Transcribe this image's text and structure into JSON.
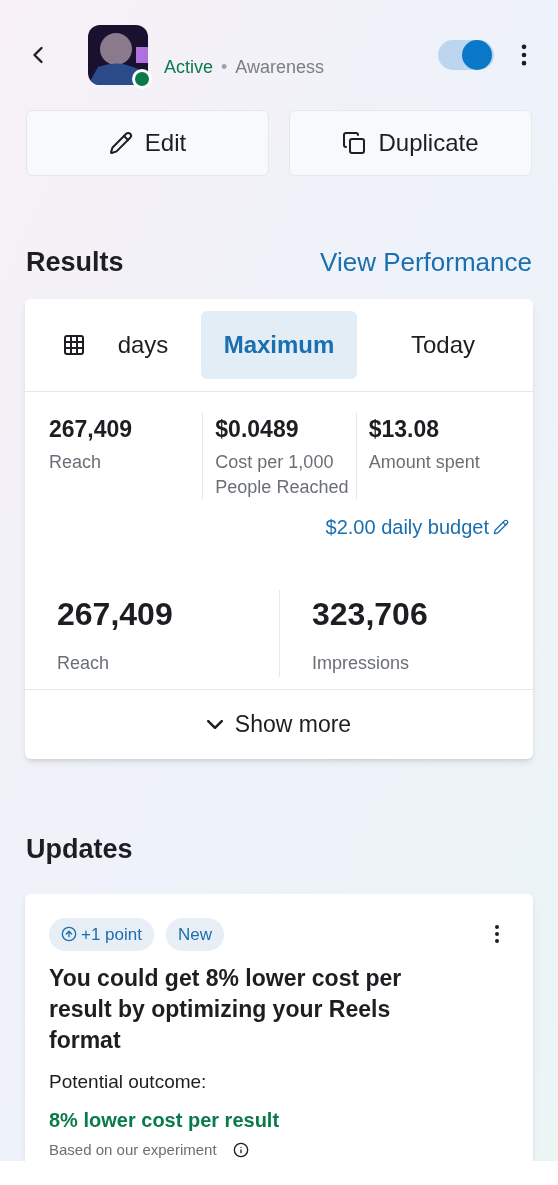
{
  "header": {
    "status": "Active",
    "separator": "•",
    "objective": "Awareness",
    "toggle_on": true
  },
  "actions": [
    {
      "kind": "edit",
      "label": "Edit"
    },
    {
      "kind": "duplicate",
      "label": "Duplicate"
    }
  ],
  "results": {
    "title": "Results",
    "link": "View Performance",
    "ranges": [
      {
        "kind": "calendar",
        "label": "days",
        "selected": false
      },
      {
        "kind": "text",
        "label": "Maximum",
        "selected": true
      },
      {
        "kind": "text",
        "label": "Today",
        "selected": false
      }
    ],
    "metrics": [
      {
        "value": "267,409",
        "label": "Reach"
      },
      {
        "value": "$0.0489",
        "label": "Cost per 1,000 People Reached"
      },
      {
        "value": "$13.08",
        "label": "Amount spent"
      }
    ],
    "budget": "$2.00 daily budget",
    "big_metrics": [
      {
        "value": "267,409",
        "label": "Reach"
      },
      {
        "value": "323,706",
        "label": "Impressions"
      }
    ],
    "show_more": "Show more"
  },
  "updates": {
    "title": "Updates",
    "card": {
      "tags": [
        {
          "kind": "points",
          "label": "+1 point"
        },
        {
          "kind": "plain",
          "label": "New"
        }
      ],
      "headline": "You could get 8% lower cost per result by optimizing your Reels format",
      "outcome_label": "Potential outcome:",
      "outcome": "8% lower cost per result",
      "note": "Based on our experiment"
    }
  }
}
